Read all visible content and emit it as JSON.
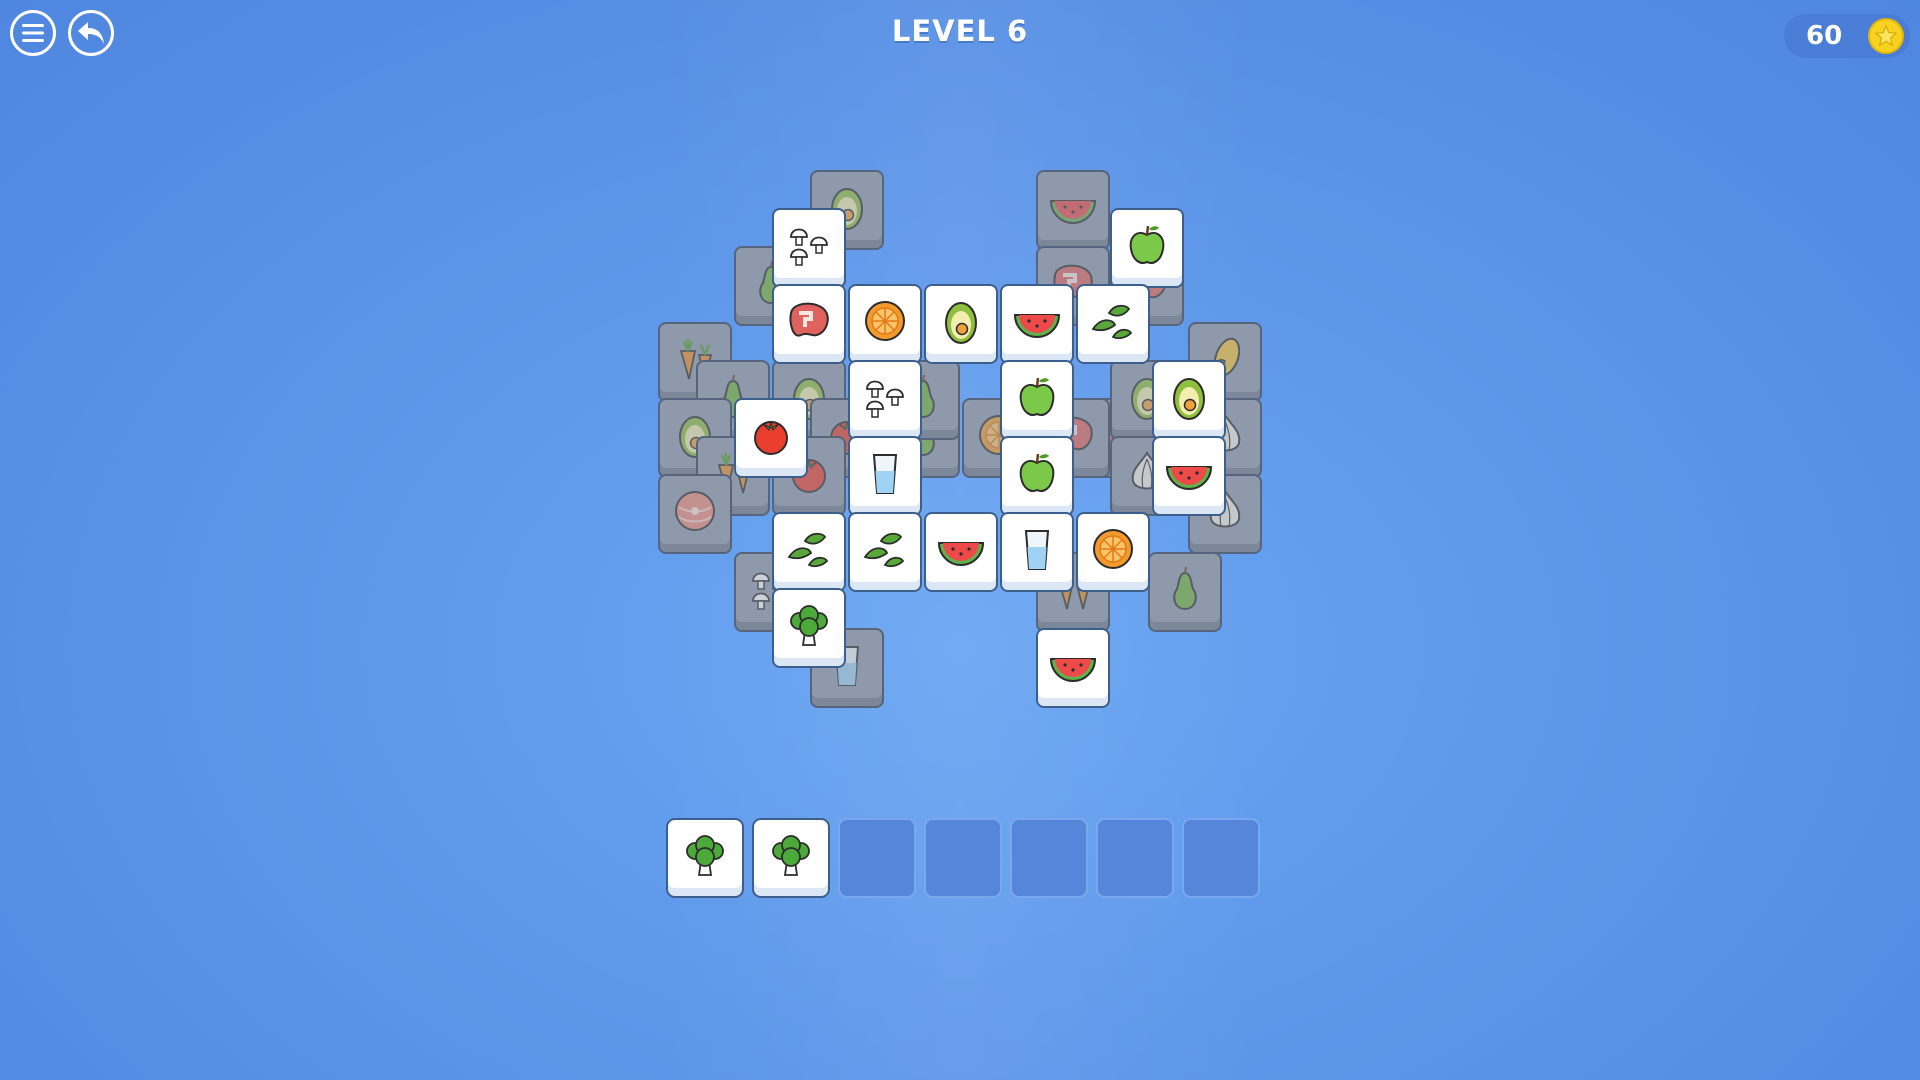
{
  "header": {
    "level_text": "LEVEL 6",
    "coins": "60"
  },
  "icons": {
    "menu": "menu-icon",
    "back": "back-arrow-icon",
    "coin": "star-coin-icon"
  },
  "tiles": [
    {
      "kind": "avocado",
      "state": "dim"
    },
    {
      "kind": "watermelon",
      "state": "dim"
    },
    {
      "kind": "pear",
      "state": "dim"
    },
    {
      "kind": "steak",
      "state": "dim"
    },
    {
      "kind": "avocado",
      "state": "dim"
    },
    {
      "kind": "steak",
      "state": "dim"
    },
    {
      "kind": "carrot",
      "state": "dim"
    },
    {
      "kind": "corn",
      "state": "dim"
    },
    {
      "kind": "pear",
      "state": "dim"
    },
    {
      "kind": "avocado",
      "state": "dim"
    },
    {
      "kind": "steak",
      "state": "dim"
    },
    {
      "kind": "avocado",
      "state": "dim"
    },
    {
      "kind": "onion",
      "state": "dim"
    },
    {
      "kind": "avocado",
      "state": "dim"
    },
    {
      "kind": "tomato",
      "state": "dim"
    },
    {
      "kind": "pear",
      "state": "dim"
    },
    {
      "kind": "orange",
      "state": "dim"
    },
    {
      "kind": "steak",
      "state": "dim"
    },
    {
      "kind": "onion",
      "state": "dim"
    },
    {
      "kind": "carrot",
      "state": "dim"
    },
    {
      "kind": "tomato",
      "state": "dim"
    },
    {
      "kind": "onion",
      "state": "dim"
    },
    {
      "kind": "salmon",
      "state": "dim"
    },
    {
      "kind": "pear",
      "state": "dim"
    },
    {
      "kind": "mushrooms",
      "state": "dim"
    },
    {
      "kind": "carrot",
      "state": "dim"
    },
    {
      "kind": "pear",
      "state": "dim"
    },
    {
      "kind": "water",
      "state": "dim"
    },
    {
      "kind": "mushrooms",
      "state": "lit"
    },
    {
      "kind": "apple",
      "state": "lit"
    },
    {
      "kind": "steak",
      "state": "lit"
    },
    {
      "kind": "orange",
      "state": "lit"
    },
    {
      "kind": "avocado",
      "state": "lit"
    },
    {
      "kind": "watermelon",
      "state": "lit"
    },
    {
      "kind": "leaves",
      "state": "lit"
    },
    {
      "kind": "mushrooms",
      "state": "lit"
    },
    {
      "kind": "apple",
      "state": "lit"
    },
    {
      "kind": "avocado",
      "state": "lit"
    },
    {
      "kind": "tomato",
      "state": "lit"
    },
    {
      "kind": "water",
      "state": "lit"
    },
    {
      "kind": "apple",
      "state": "lit"
    },
    {
      "kind": "watermelon",
      "state": "lit"
    },
    {
      "kind": "leaves",
      "state": "lit"
    },
    {
      "kind": "leaves",
      "state": "lit"
    },
    {
      "kind": "watermelon",
      "state": "lit"
    },
    {
      "kind": "water",
      "state": "lit"
    },
    {
      "kind": "orange",
      "state": "lit"
    },
    {
      "kind": "broccoli",
      "state": "lit"
    },
    {
      "kind": "watermelon",
      "state": "lit"
    }
  ],
  "tray": [
    "broccoli",
    "broccoli",
    "",
    "",
    "",
    "",
    ""
  ]
}
